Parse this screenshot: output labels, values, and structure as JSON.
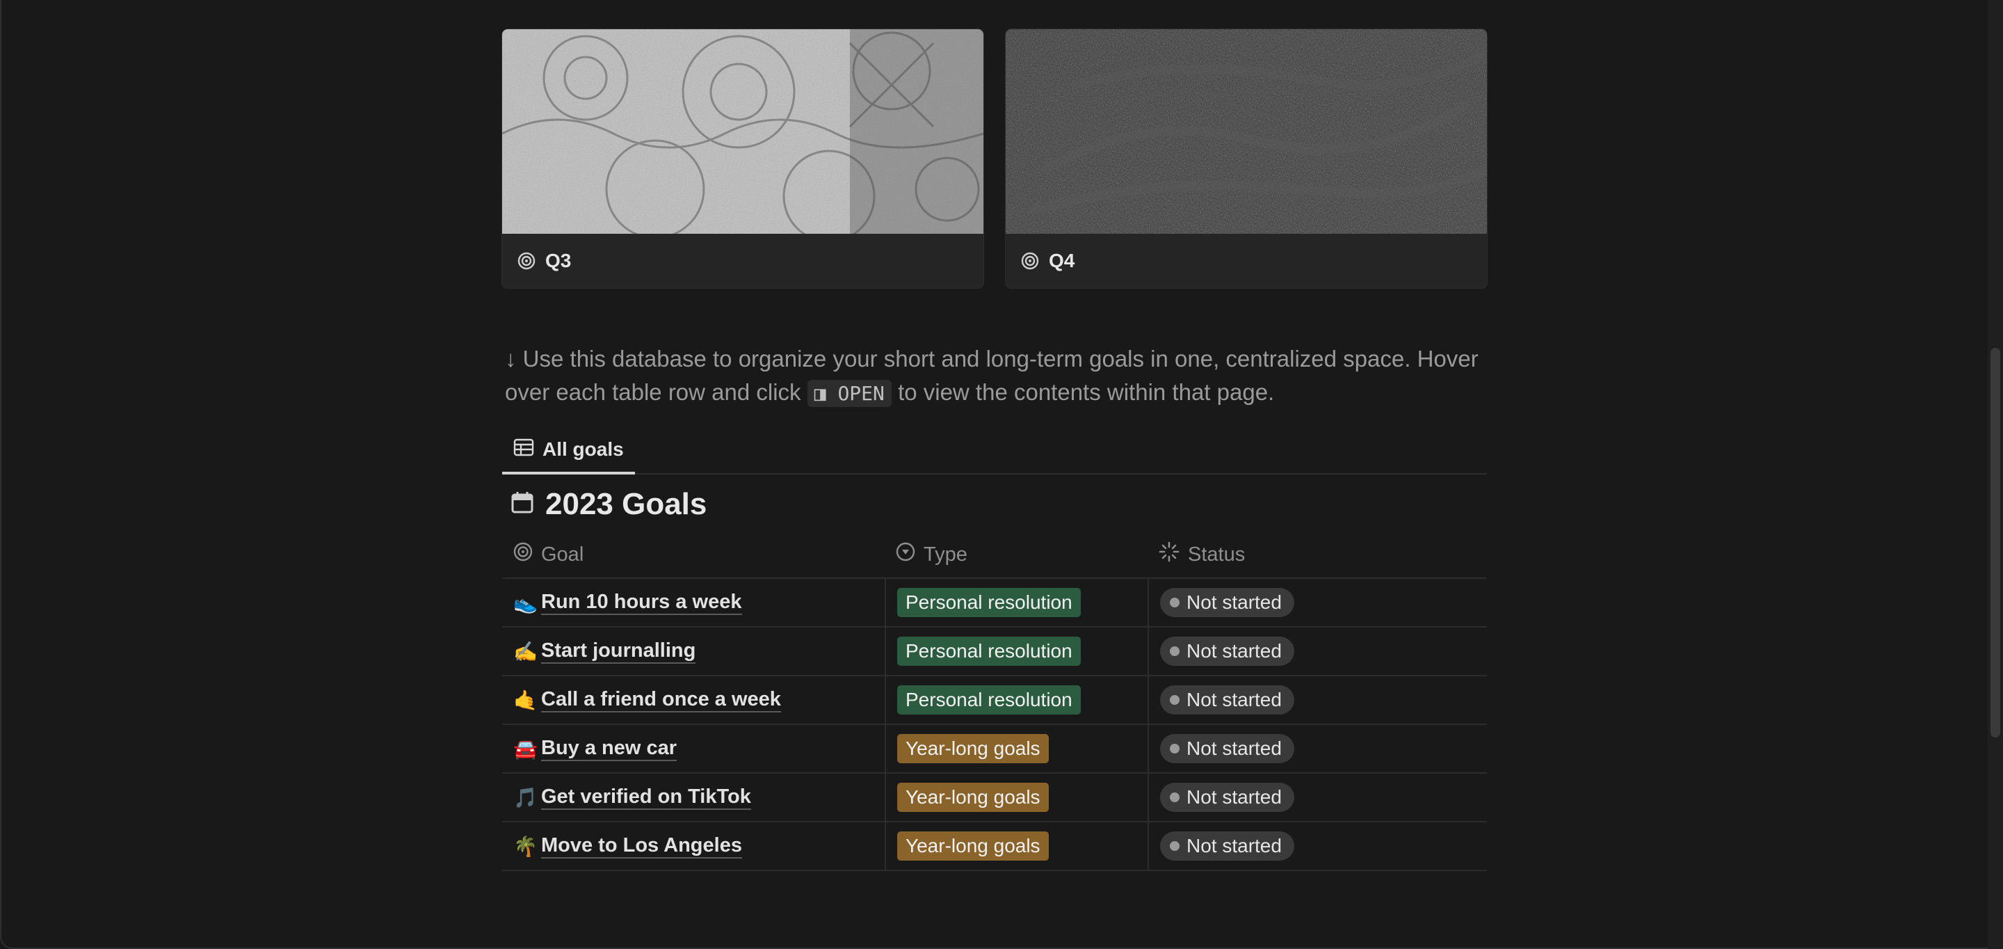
{
  "gallery": {
    "cards": [
      {
        "label": "Q3",
        "icon": "target-icon"
      },
      {
        "label": "Q4",
        "icon": "target-icon"
      }
    ]
  },
  "description": {
    "arrow": "↓",
    "before": "Use this database to organize your short and long-term goals in one, centralized space. Hover over each table row and click",
    "code": "◨ OPEN",
    "after": "to view the contents within that page."
  },
  "tabs": [
    {
      "label": "All goals",
      "icon": "table-icon",
      "active": true
    }
  ],
  "database": {
    "title": "2023 Goals",
    "icon": "calendar-icon",
    "columns": [
      {
        "label": "Goal",
        "icon": "target-icon"
      },
      {
        "label": "Type",
        "icon": "select-icon"
      },
      {
        "label": "Status",
        "icon": "status-icon"
      }
    ],
    "rows": [
      {
        "emoji": "👟",
        "goal": "Run 10 hours a week",
        "type": "Personal resolution",
        "type_color": "#2b5c3f",
        "status": "Not started"
      },
      {
        "emoji": "✍️",
        "goal": "Start journalling",
        "type": "Personal resolution",
        "type_color": "#2b5c3f",
        "status": "Not started"
      },
      {
        "emoji": "🤙",
        "goal": "Call a friend once a week",
        "type": "Personal resolution",
        "type_color": "#2b5c3f",
        "status": "Not started"
      },
      {
        "emoji": "🚘",
        "goal": "Buy a new car",
        "type": "Year-long goals",
        "type_color": "#89632a",
        "status": "Not started"
      },
      {
        "emoji": "🎵",
        "goal": "Get verified on TikTok",
        "type": "Year-long goals",
        "type_color": "#89632a",
        "status": "Not started"
      },
      {
        "emoji": "🌴",
        "goal": "Move to Los Angeles",
        "type": "Year-long goals",
        "type_color": "#89632a",
        "status": "Not started"
      }
    ]
  }
}
